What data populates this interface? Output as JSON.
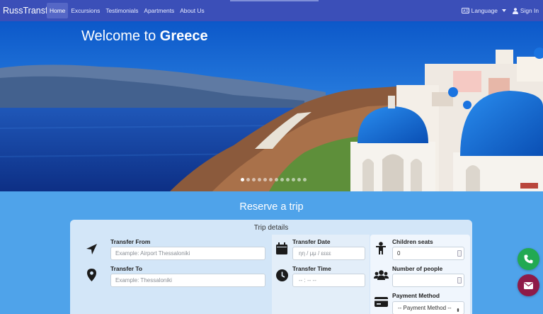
{
  "navbar": {
    "brand": "RussTransfer",
    "links": [
      "Home",
      "Excursions",
      "Testimonials",
      "Apartments",
      "About Us"
    ],
    "language_label": "Language",
    "signin_label": "Sign In"
  },
  "hero": {
    "title_prefix": "Welcome to ",
    "title_bold": "Greece",
    "slide_count": 12,
    "active_slide": 1
  },
  "reserve": {
    "section_title": "Reserve a trip",
    "card_title": "Trip details",
    "transfer_from": {
      "label": "Transfer From",
      "placeholder": "Example: Airport Thessaloniki"
    },
    "transfer_to": {
      "label": "Transfer To",
      "placeholder": "Example: Thessaloniki"
    },
    "transfer_date": {
      "label": "Transfer Date",
      "placeholder": "ηη / μμ / εεεε"
    },
    "transfer_time": {
      "label": "Transfer Time",
      "placeholder": "-- : --   --"
    },
    "children_seats": {
      "label": "Children seats",
      "value": "0"
    },
    "number_of_people": {
      "label": "Number of people",
      "value": ""
    },
    "payment_method": {
      "label": "Payment Method",
      "selected": "-- Payment Method --"
    }
  },
  "colors": {
    "navbar": "#3b4fb8",
    "page_bg": "#4fa3ea",
    "phone_button": "#22a952",
    "mail_button": "#8e1b48"
  }
}
